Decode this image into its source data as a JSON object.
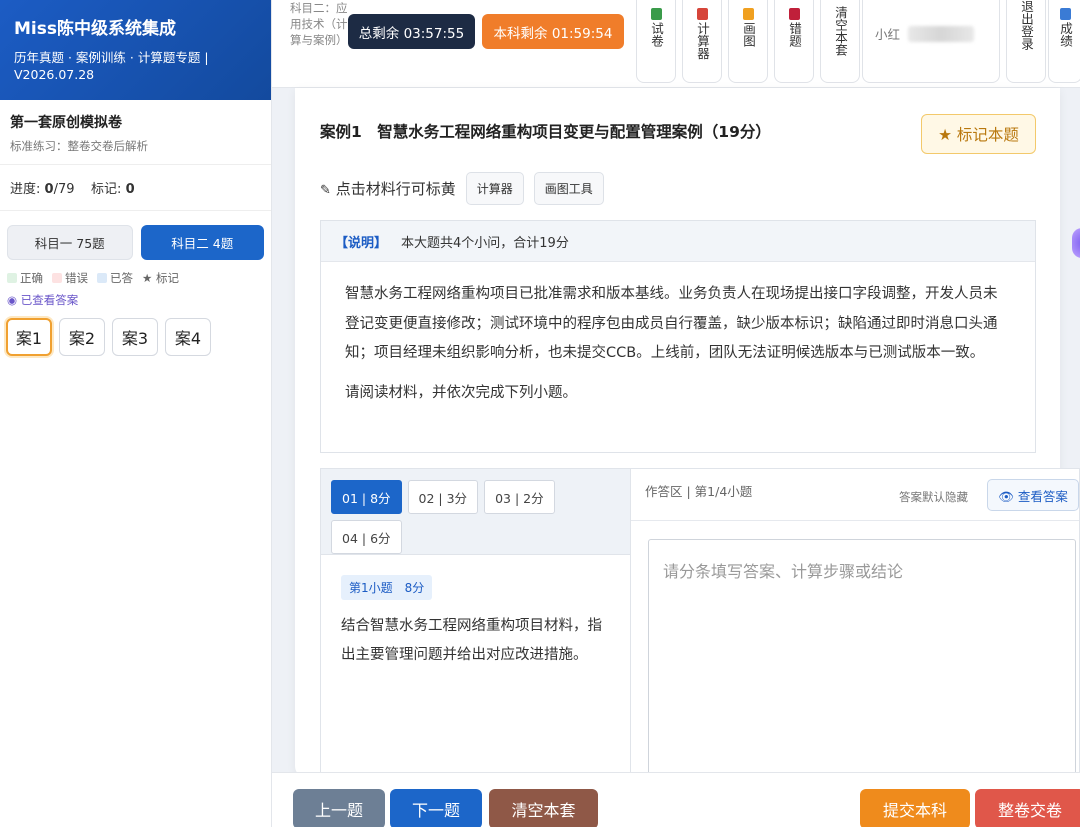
{
  "sidebar": {
    "brand_title": "Miss陈中级系统集成",
    "brand_sub": "历年真题 · 案例训练 · 计算题专题 | V2026.07.28",
    "paper_title": "第一套原创模拟卷",
    "paper_sub": "标准练习：整卷交卷后解析",
    "progress_label": "进度:",
    "progress_done": "0",
    "progress_total": "/79",
    "marked_label": "标记:",
    "marked_count": "0",
    "subjects": [
      "科目一 75题",
      "科目二 4题"
    ],
    "legend": [
      "正确",
      "错误",
      "已答",
      "★ 标记"
    ],
    "legend_colors": [
      "#dff2e3",
      "#fde2e2",
      "#dbe9f8"
    ],
    "viewed_label": "◉ 已查看答案",
    "cases": [
      "案1",
      "案2",
      "案3",
      "案4"
    ]
  },
  "topbar": {
    "subject_label": "科目二：应用技术（计算与案例）",
    "timer_total": "总剩余 03:57:55",
    "timer_subject": "本科剩余 01:59:54",
    "tools": [
      {
        "label": "试卷",
        "icon": "paper-icon",
        "color": "#3a9b4a"
      },
      {
        "label": "计算器",
        "icon": "calculator-icon",
        "color": "#d6453a"
      },
      {
        "label": "画图",
        "icon": "pencil-icon",
        "color": "#f0a020"
      },
      {
        "label": "错题",
        "icon": "book-icon",
        "color": "#c0203a"
      },
      {
        "label": "清空本套",
        "icon": "broom-icon",
        "color": "#888888"
      },
      {
        "label": "退出登录",
        "icon": "exit-icon",
        "color": "#888888"
      },
      {
        "label": "成绩",
        "icon": "chart-icon",
        "color": "#3a7bd5"
      }
    ],
    "user_name": "小红"
  },
  "case": {
    "title": "案例1　智慧水务工程网络重构项目变更与配置管理案例（19分）",
    "mark_label": "★ 标记本题",
    "highlight_hint": "点击材料行可标黄",
    "calc_btn": "计算器",
    "draw_btn": "画图工具",
    "info_label": "【说明】",
    "info_text": "本大题共4个小问，合计19分",
    "material_p1": "智慧水务工程网络重构项目已批准需求和版本基线。业务负责人在现场提出接口字段调整，开发人员未登记变更便直接修改；测试环境中的程序包由成员自行覆盖，缺少版本标识；缺陷通过即时消息口头通知；项目经理未组织影响分析，也未提交CCB。上线前，团队无法证明候选版本与已测试版本一致。",
    "material_p2": "请阅读材料，并依次完成下列小题。"
  },
  "questions": {
    "tabs": [
      "01 | 8分",
      "02 | 3分",
      "03 | 2分",
      "04 | 6分"
    ],
    "badge": "第1小题　8分",
    "text": "结合智慧水务工程网络重构项目材料，指出主要管理问题并给出对应改进措施。"
  },
  "answer": {
    "header": "作答区 | 第1/4小题",
    "hidden_label": "答案默认隐藏",
    "view_btn": "👁 查看答案",
    "placeholder": "请分条填写答案、计算步骤或结论"
  },
  "footer": {
    "prev": "上一题",
    "next": "下一题",
    "clear": "清空本套",
    "submit_subject": "提交本科",
    "submit_all": "整卷交卷"
  }
}
